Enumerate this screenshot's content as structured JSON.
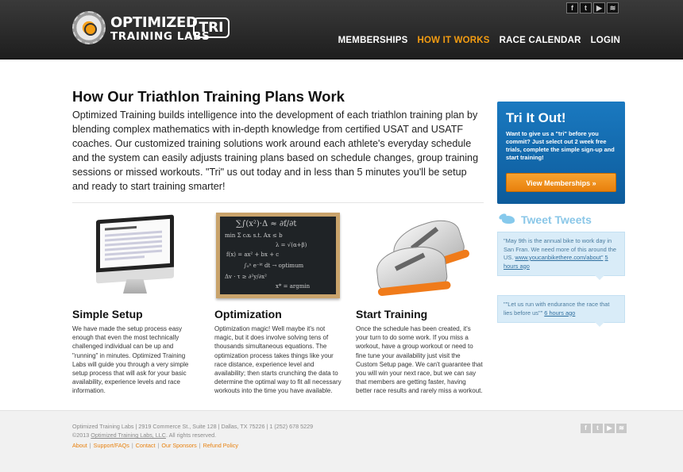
{
  "header": {
    "logo": {
      "line1": "OPTIMIZED",
      "line2": "TRAINING LABS",
      "badge": "TRI"
    },
    "social": [
      {
        "icon": "facebook-icon",
        "glyph": "f"
      },
      {
        "icon": "twitter-icon",
        "glyph": "t"
      },
      {
        "icon": "youtube-icon",
        "glyph": "▶"
      },
      {
        "icon": "rss-icon",
        "glyph": "≋"
      }
    ],
    "nav": [
      {
        "label": "MEMBERSHIPS",
        "active": false
      },
      {
        "label": "HOW IT WORKS",
        "active": true
      },
      {
        "label": "RACE CALENDAR",
        "active": false
      },
      {
        "label": "LOGIN",
        "active": false
      }
    ]
  },
  "main": {
    "title": "How Our Triathlon Training Plans Work",
    "intro": "Optimized Training builds intelligence into the development of each triathlon training plan by blending complex mathematics with in-depth knowledge from certified USAT and USATF coaches. Our customized training solutions work around each athlete's everyday schedule and the system can easily adjusts training plans based on schedule changes, group training sessions or missed workouts. \"Tri\" us out today and in less than 5 minutes you'll be setup and ready to start training smarter!",
    "features": [
      {
        "title": "Simple Setup",
        "text": "We have made the setup process easy enough that even the most technically challenged individual can be up and \"running\" in minutes. Optimized Training Labs will guide you through a very simple setup process that will ask for your basic availability, experience levels and race information."
      },
      {
        "title": "Optimization",
        "text": "Optimization magic! Well maybe it's not magic, but it does involve solving tens of thousands simultaneous equations. The optimization process takes things like your race distance, experience level and availability; then starts crunching the data to determine the optimal way to fit all necessary workouts into the time you have available."
      },
      {
        "title": "Start Training",
        "text": "Once the schedule has been created, it's your turn to do some work. If you miss a workout, have a group workout or need to fine tune your availability just visit the Custom Setup page. We can't guarantee that you will win your next race, but we can say that members are getting faster, having better race results and rarely miss a workout."
      }
    ]
  },
  "sidebar": {
    "promo": {
      "title": "Tri It Out!",
      "text": "Want to give us a \"tri\" before you commit? Just select out 2 week free trials, complete the simple sign-up and start training!",
      "button": "View Memberships »"
    },
    "tweets_title": "Tweet Tweets",
    "tweets": [
      {
        "text": "\"May 9th is the annual bike to work day in San Fran. We need more of this around the US.",
        "link": "www.youcanbikethere.com/about\"",
        "time": "5 hours ago"
      },
      {
        "text": "\"\"Let us run with endurance the race that lies before us\"\"",
        "link": "",
        "time": "6 hours ago"
      }
    ]
  },
  "footer": {
    "address": "Optimized Training Labs  |  2919 Commerce St., Suite 128  |  Dallas, TX 75226  |  1 (252) 678 5229",
    "copyright_prefix": "©2013 ",
    "copyright_link": "Optimized Training Labs, LLC",
    "copyright_suffix": ". All rights reserved.",
    "links": [
      "About",
      "Support/FAQs",
      "Contact",
      "Our Sponsors",
      "Refund Policy"
    ],
    "social": [
      {
        "icon": "facebook-icon",
        "glyph": "f"
      },
      {
        "icon": "twitter-icon",
        "glyph": "t"
      },
      {
        "icon": "youtube-icon",
        "glyph": "▶"
      },
      {
        "icon": "rss-icon",
        "glyph": "≋"
      }
    ]
  }
}
